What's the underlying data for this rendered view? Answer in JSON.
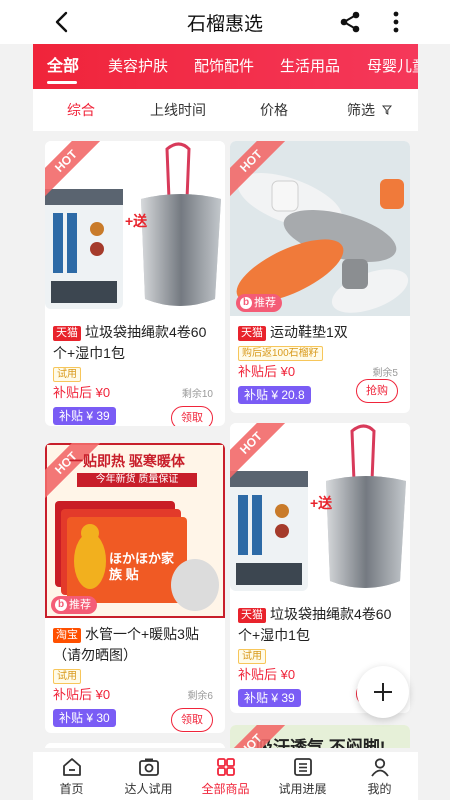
{
  "header": {
    "title": "石榴惠选"
  },
  "categories": [
    "全部",
    "美容护肤",
    "配饰配件",
    "生活用品",
    "母婴儿童"
  ],
  "sort": {
    "items": [
      "综合",
      "上线时间",
      "价格",
      "筛选"
    ]
  },
  "cards": [
    {
      "hot": "HOT",
      "image_text": "+送",
      "platform": "天猫",
      "title": "垃圾袋抽绳款4卷60个+湿巾1包",
      "chip": "试用",
      "price_label": "补贴后 ¥0",
      "stock": "剩余10",
      "subsidy": "补贴 ¥ 39",
      "button": "领取"
    },
    {
      "hot": "HOT",
      "rec": "推荐",
      "platform": "天猫",
      "title": "运动鞋垫1双",
      "chip": "购后返100石榴籽",
      "price_label": "补贴后 ¥0",
      "stock": "剩余5",
      "subsidy": "补贴 ¥ 20.8",
      "button": "抢购"
    },
    {
      "hot": "HOT",
      "rec": "推荐",
      "banner1": "一贴即热  驱寒暖体",
      "banner2": "今年新货  质量保证",
      "product_text": "ほかほか家族 贴",
      "platform": "淘宝",
      "title": "水管一个+暖贴3贴（请勿晒图）",
      "chip": "试用",
      "price_label": "补贴后 ¥0",
      "stock": "剩余6",
      "subsidy": "补贴 ¥ 30",
      "button": "领取"
    },
    {
      "hot": "HOT",
      "image_text": "+送",
      "platform": "天猫",
      "title": "垃圾袋抽绳款4卷60个+湿巾1包",
      "chip": "试用",
      "price_label": "补贴后 ¥0",
      "subsidy": "补贴 ¥ 39",
      "button": "领取"
    },
    {
      "hot": "HOT",
      "image_text": "吸汗透气,不闷脚!"
    }
  ],
  "tabbar": [
    "首页",
    "达人试用",
    "全部商品",
    "试用进展",
    "我的"
  ],
  "colors": {
    "accent": "#f0243a",
    "subsidy": "#7a5cf5",
    "chip_border": "#f7c65a"
  }
}
